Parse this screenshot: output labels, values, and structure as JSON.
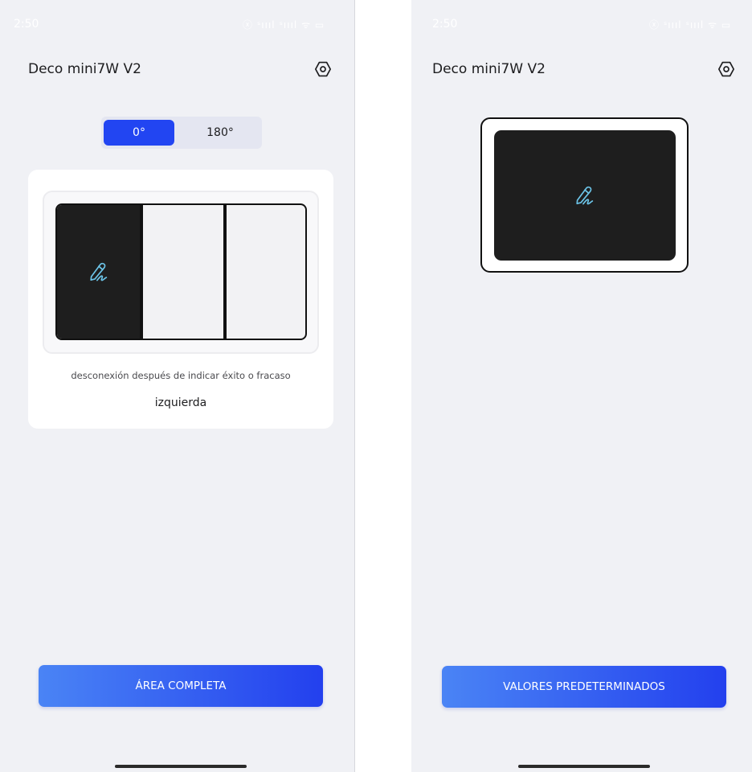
{
  "left_screen": {
    "status": {
      "time": "2:50",
      "icons": "ⓧ ˢıııl ˢıııl ᯤ ▭"
    },
    "title": "Deco mini7W V2",
    "settings_icon": "hexagon-gear-icon",
    "rotation": {
      "options": [
        "0°",
        "180°"
      ],
      "selected": "0°"
    },
    "panes": [
      {
        "id": "left",
        "active": true,
        "icon": "pen-signature-icon"
      },
      {
        "id": "center",
        "active": false
      },
      {
        "id": "right",
        "active": false
      }
    ],
    "caption": "desconexión después de indicar éxito o fracaso",
    "selected_side": "izquierda",
    "action_button": "ÁREA COMPLETA"
  },
  "right_screen": {
    "status": {
      "time": "2:50",
      "icons": "ⓧ ˢıııl ˢıııl ᯤ ▭"
    },
    "title": "Deco mini7W V2",
    "settings_icon": "hexagon-gear-icon",
    "device_icon": "pen-signature-icon",
    "action_button": "VALORES PREDETERMINADOS"
  },
  "colors": {
    "accent": "#2245f2",
    "gradient_start": "#4a84f5",
    "gradient_end": "#2340ee",
    "pen_icon": "#6cc4e8",
    "background": "#f0f1f5",
    "screen_dark": "#1e1e1e"
  }
}
